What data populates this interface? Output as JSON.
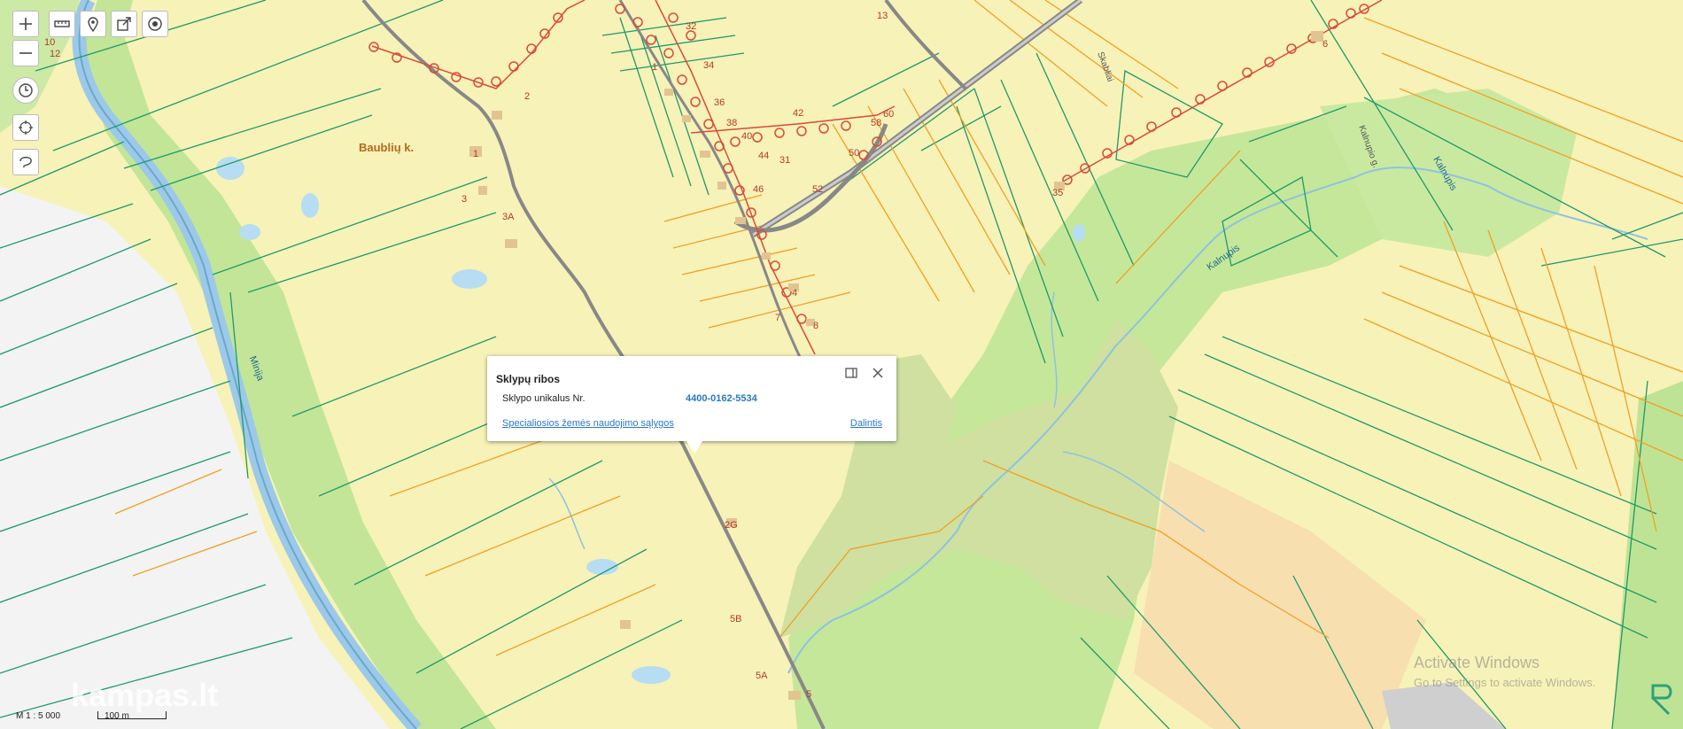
{
  "popup": {
    "title": "Sklypų ribos",
    "field_label": "Sklypo unikalus Nr.",
    "field_value": "4400-0162-5534",
    "link_conditions": "Specialiosios žemės naudojimo sąlygos",
    "link_share": "Dalintis"
  },
  "map": {
    "place_name": "Baublių k.",
    "river_minija": "Minija",
    "river_kalnupis_1": "Kalnupis",
    "river_kalnupis_2": "Kalnupis",
    "road_kalnupio": "Kalnupio g.",
    "road_skabliai": "Skabliai",
    "plot_numbers": [
      "1",
      "2",
      "3",
      "3A",
      "2G",
      "5B",
      "5A",
      "5",
      "35",
      "6",
      "12",
      "10",
      "13",
      "32",
      "34",
      "36",
      "38",
      "40",
      "42",
      "44",
      "46",
      "50",
      "52",
      "58",
      "60",
      "8",
      "7",
      "4",
      "31",
      "1"
    ]
  },
  "scale": {
    "ratio": "M 1 : 5 000",
    "bar_label": "100 m"
  },
  "overlay": {
    "windows_title": "Activate Windows",
    "windows_sub": "Go to Settings to activate Windows.",
    "brand": "kampas.lt"
  },
  "colors": {
    "land_yellow": "#f7f2b8",
    "green": "#b9e08a",
    "river": "#b7ddf2",
    "parcel_green": "#1e9a6a",
    "parcel_orange": "#f0a024",
    "powerline": "#d94a3a"
  }
}
